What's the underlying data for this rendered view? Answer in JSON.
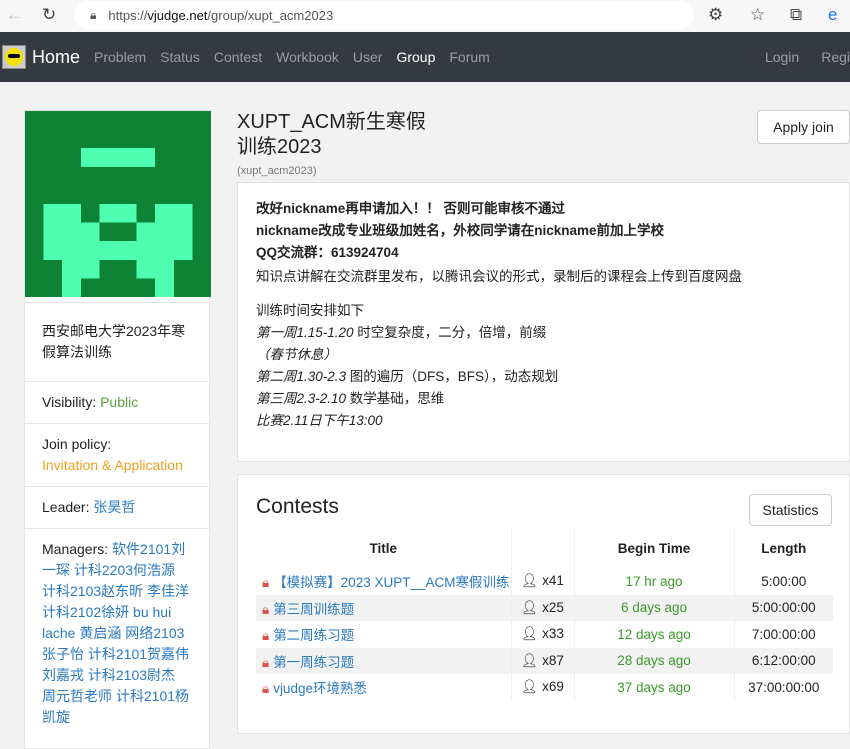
{
  "browser": {
    "url_domain": "vjudge.net",
    "url_prefix": "https://",
    "url_path": "/group/xupt_acm2023"
  },
  "nav": {
    "brand": "Home",
    "items": [
      "Problem",
      "Status",
      "Contest",
      "Workbook",
      "User",
      "Group",
      "Forum"
    ],
    "active": "Group",
    "right": [
      "Login",
      "Regi"
    ]
  },
  "sidebar": {
    "group_name": "西安邮电大学2023年寒假算法训练",
    "visibility_label": "Visibility:",
    "visibility": "Public",
    "join_label": "Join policy:",
    "join": "Invitation & Application",
    "leader_label": "Leader:",
    "leader": "张昊哲",
    "managers_label": "Managers:",
    "managers": "软件2101刘一琛 计科2203何浩源 计科2103赵东昕 李佳洋 计科2102徐妍 bu hui lache 黄启涵 网络2103张子怡 计科2101贺嘉伟 刘嘉戎 计科2103尉杰 周元哲老师 计科2101杨凯旋"
  },
  "header": {
    "title": "XUPT_ACM新生寒假训练2023",
    "subtitle": "(xupt_acm2023)",
    "apply": "Apply join"
  },
  "description": {
    "lines": [
      "改好nickname再申请加入！！ 否则可能审核不通过",
      "nickname改成专业班级加姓名，外校同学请在nickname前加上学校",
      "QQ交流群：613924704",
      "知识点讲解在交流群里发布，以腾讯会议的形式，录制后的课程会上传到百度网盘"
    ],
    "schedule_title": "训练时间安排如下",
    "schedule": [
      {
        "week": "第一周1.15-1.20",
        "topic": " 时空复杂度，二分，倍增，前缀"
      },
      {
        "week": "（春节休息）",
        "topic": ""
      },
      {
        "week": "第二周1.30-2.3",
        "topic": " 图的遍历（DFS，BFS），动态规划"
      },
      {
        "week": "第三周2.3-2.10",
        "topic": " 数学基础，思维"
      },
      {
        "week": "比赛2.11日下午13:00",
        "topic": ""
      }
    ]
  },
  "contests": {
    "title": "Contests",
    "statistics": "Statistics",
    "columns": [
      "Title",
      "",
      "Begin Time",
      "Length"
    ],
    "rows": [
      {
        "title": "【模拟赛】2023 XUPT__ACM寒假训练",
        "count": "x41",
        "begin": "17 hr ago",
        "length": "5:00:00"
      },
      {
        "title": "第三周训练题",
        "count": "x25",
        "begin": "6 days ago",
        "length": "5:00:00:00"
      },
      {
        "title": "第二周练习题",
        "count": "x33",
        "begin": "12 days ago",
        "length": "7:00:00:00"
      },
      {
        "title": "第一周练习题",
        "count": "x87",
        "begin": "28 days ago",
        "length": "6:12:00:00"
      },
      {
        "title": "vjudge环境熟悉",
        "count": "x69",
        "begin": "37 days ago",
        "length": "37:00:00:00"
      }
    ]
  }
}
